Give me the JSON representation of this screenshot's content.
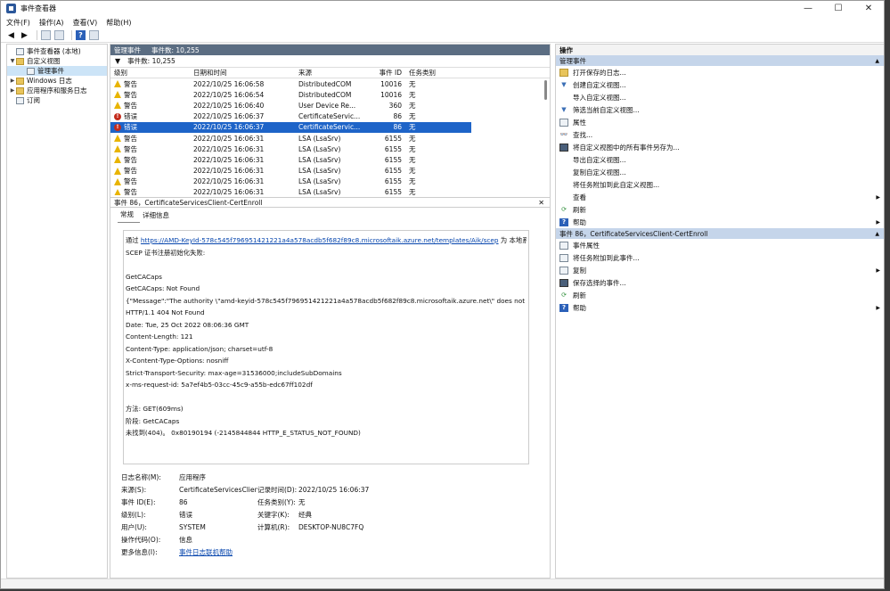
{
  "window": {
    "title": "事件查看器",
    "minimize": "—",
    "maximize": "☐",
    "close": "✕"
  },
  "menu": [
    "文件(F)",
    "操作(A)",
    "查看(V)",
    "帮助(H)"
  ],
  "tree": {
    "root": "事件查看器 (本地)",
    "custom_views": "自定义视图",
    "admin_events": "管理事件",
    "windows_logs": "Windows 日志",
    "app_service_logs": "应用程序和服务日志",
    "subscriptions": "订阅"
  },
  "list": {
    "header_title": "管理事件",
    "header_count": "事件数: 10,255",
    "filter_text": "事件数: 10,255",
    "columns": {
      "level": "级别",
      "date": "日期和时间",
      "source": "来源",
      "id": "事件 ID",
      "task": "任务类别"
    },
    "rows": [
      {
        "level": "警告",
        "date": "2022/10/25 16:06:58",
        "source": "DistributedCOM",
        "id": "10016",
        "task": "无",
        "type": "warn"
      },
      {
        "level": "警告",
        "date": "2022/10/25 16:06:54",
        "source": "DistributedCOM",
        "id": "10016",
        "task": "无",
        "type": "warn"
      },
      {
        "level": "警告",
        "date": "2022/10/25 16:06:40",
        "source": "User Device Re...",
        "id": "360",
        "task": "无",
        "type": "warn"
      },
      {
        "level": "错误",
        "date": "2022/10/25 16:06:37",
        "source": "CertificateServic...",
        "id": "86",
        "task": "无",
        "type": "err"
      },
      {
        "level": "错误",
        "date": "2022/10/25 16:06:37",
        "source": "CertificateServic...",
        "id": "86",
        "task": "无",
        "type": "err"
      },
      {
        "level": "警告",
        "date": "2022/10/25 16:06:31",
        "source": "LSA (LsaSrv)",
        "id": "6155",
        "task": "无",
        "type": "warn"
      },
      {
        "level": "警告",
        "date": "2022/10/25 16:06:31",
        "source": "LSA (LsaSrv)",
        "id": "6155",
        "task": "无",
        "type": "warn"
      },
      {
        "level": "警告",
        "date": "2022/10/25 16:06:31",
        "source": "LSA (LsaSrv)",
        "id": "6155",
        "task": "无",
        "type": "warn"
      },
      {
        "level": "警告",
        "date": "2022/10/25 16:06:31",
        "source": "LSA (LsaSrv)",
        "id": "6155",
        "task": "无",
        "type": "warn"
      },
      {
        "level": "警告",
        "date": "2022/10/25 16:06:31",
        "source": "LSA (LsaSrv)",
        "id": "6155",
        "task": "无",
        "type": "warn"
      },
      {
        "level": "警告",
        "date": "2022/10/25 16:06:31",
        "source": "LSA (LsaSrv)",
        "id": "6155",
        "task": "无",
        "type": "warn"
      }
    ],
    "selected_row": 4
  },
  "detail": {
    "header": "事件 86，CertificateServicesClient-CertEnroll",
    "close": "✕",
    "tab_general": "常规",
    "tab_details": "详细信息",
    "msg_prefix": "通过 ",
    "msg_link": "https://AMD-KeyId-578c545f796951421221a4a578acdb5f682f89c8.microsoftaik.azure.net/templates/Aik/scep",
    "msg_suffix": " 为 本地系统 执行",
    "lines": [
      "SCEP 证书注册初始化失败:",
      "",
      "GetCACaps",
      "GetCACaps: Not Found",
      "{\"Message\":\"The authority \\\"amd-keyid-578c545f796951421221a4a578acdb5f682f89c8.microsoftaik.azure.net\\\" does not exist.\"}",
      "HTTP/1.1 404 Not Found",
      "Date: Tue, 25 Oct 2022 08:06:36 GMT",
      "Content-Length: 121",
      "Content-Type: application/json; charset=utf-8",
      "X-Content-Type-Options: nosniff",
      "Strict-Transport-Security: max-age=31536000;includeSubDomains",
      "x-ms-request-id: 5a7ef4b5-03cc-45c9-a55b-edc67ff102df",
      "",
      "方法: GET(609ms)",
      "阶段: GetCACaps",
      "未找到(404)。 0x80190194 (-2145844844 HTTP_E_STATUS_NOT_FOUND)"
    ],
    "props": {
      "log_name_label": "日志名称(M):",
      "log_name": "应用程序",
      "source_label": "来源(S):",
      "source": "CertificateServicesClient-C",
      "recorded_label": "记录时间(D):",
      "recorded": "2022/10/25 16:06:37",
      "event_id_label": "事件 ID(E):",
      "event_id": "86",
      "task_label": "任务类别(Y):",
      "task": "无",
      "level_label": "级别(L):",
      "level": "错误",
      "keywords_label": "关键字(K):",
      "keywords": "经典",
      "user_label": "用户(U):",
      "user": "SYSTEM",
      "computer_label": "计算机(R):",
      "computer": "DESKTOP-NU8C7FQ",
      "opcode_label": "操作代码(O):",
      "opcode": "信息",
      "more_label": "更多信息(I):",
      "more_link": "事件日志联机帮助"
    }
  },
  "actions": {
    "title": "操作",
    "section1": "管理事件",
    "items1": [
      {
        "label": "打开保存的日志...",
        "icon": "folder-icon"
      },
      {
        "label": "创建自定义视图...",
        "icon": "filter-icon"
      },
      {
        "label": "导入自定义视图...",
        "icon": "none"
      },
      {
        "label": "筛选当前自定义视图...",
        "icon": "filter-icon"
      },
      {
        "label": "属性",
        "icon": "properties-icon"
      },
      {
        "label": "查找...",
        "icon": "find-icon"
      },
      {
        "label": "将自定义视图中的所有事件另存为...",
        "icon": "save-icon"
      },
      {
        "label": "导出自定义视图...",
        "icon": "none"
      },
      {
        "label": "复制自定义视图...",
        "icon": "none"
      },
      {
        "label": "将任务附加到此自定义视图...",
        "icon": "none"
      },
      {
        "label": "查看",
        "icon": "none",
        "submenu": true
      },
      {
        "label": "刷新",
        "icon": "refresh-icon"
      },
      {
        "label": "帮助",
        "icon": "help-icon",
        "submenu": true
      }
    ],
    "section2": "事件 86，CertificateServicesClient-CertEnroll",
    "items2": [
      {
        "label": "事件属性",
        "icon": "properties-icon"
      },
      {
        "label": "将任务附加到此事件...",
        "icon": "task-icon"
      },
      {
        "label": "复制",
        "icon": "copy-icon",
        "submenu": true
      },
      {
        "label": "保存选择的事件...",
        "icon": "save-icon"
      },
      {
        "label": "刷新",
        "icon": "refresh-icon"
      },
      {
        "label": "帮助",
        "icon": "help-icon",
        "submenu": true
      }
    ]
  }
}
